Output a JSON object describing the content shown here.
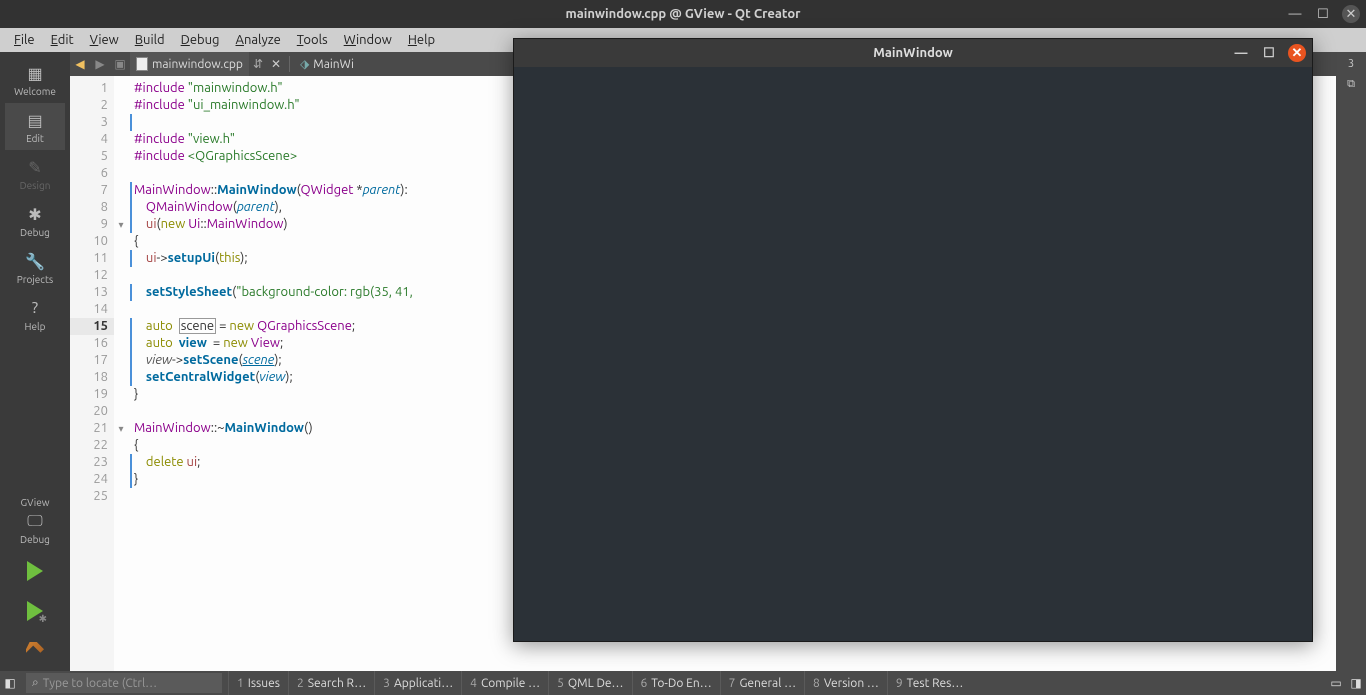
{
  "window": {
    "title": "mainwindow.cpp @ GView - Qt Creator"
  },
  "menu": [
    "File",
    "Edit",
    "View",
    "Build",
    "Debug",
    "Analyze",
    "Tools",
    "Window",
    "Help"
  ],
  "sidebar": {
    "items": [
      {
        "label": "Welcome",
        "icon": "grid"
      },
      {
        "label": "Edit",
        "icon": "doc",
        "active": true
      },
      {
        "label": "Design",
        "icon": "pencil",
        "disabled": true
      },
      {
        "label": "Debug",
        "icon": "bug"
      },
      {
        "label": "Projects",
        "icon": "wrench"
      },
      {
        "label": "Help",
        "icon": "help"
      }
    ],
    "project": "GView",
    "config": "Debug"
  },
  "tabs": {
    "current": "mainwindow.cpp",
    "secondary": "MainWi"
  },
  "code_lines": [
    [
      {
        "t": "pp",
        "s": "#include "
      },
      {
        "t": "str",
        "s": "\"mainwindow.h\""
      }
    ],
    [
      {
        "t": "pp",
        "s": "#include "
      },
      {
        "t": "str",
        "s": "\"ui_mainwindow.h\""
      }
    ],
    [],
    [
      {
        "t": "pp",
        "s": "#include "
      },
      {
        "t": "str",
        "s": "\"view.h\""
      }
    ],
    [
      {
        "t": "pp",
        "s": "#include "
      },
      {
        "t": "inc",
        "s": "<QGraphicsScene>"
      }
    ],
    [],
    [
      {
        "t": "cls",
        "s": "MainWindow"
      },
      {
        "t": "",
        "s": "::"
      },
      {
        "t": "fn",
        "s": "MainWindow"
      },
      {
        "t": "",
        "s": "("
      },
      {
        "t": "cls",
        "s": "QWidget"
      },
      {
        "t": "",
        "s": " *"
      },
      {
        "t": "ital",
        "s": "parent"
      },
      {
        "t": "",
        "s": "):"
      }
    ],
    [
      {
        "t": "",
        "s": "    "
      },
      {
        "t": "cls",
        "s": "QMainWindow"
      },
      {
        "t": "",
        "s": "("
      },
      {
        "t": "ital",
        "s": "parent"
      },
      {
        "t": "",
        "s": "),"
      }
    ],
    [
      {
        "t": "",
        "s": "    "
      },
      {
        "t": "member",
        "s": "ui"
      },
      {
        "t": "",
        "s": "("
      },
      {
        "t": "kw",
        "s": "new"
      },
      {
        "t": "",
        "s": " "
      },
      {
        "t": "cls",
        "s": "Ui"
      },
      {
        "t": "",
        "s": "::"
      },
      {
        "t": "cls",
        "s": "MainWindow"
      },
      {
        "t": "",
        "s": ")"
      }
    ],
    [
      {
        "t": "",
        "s": "{"
      }
    ],
    [
      {
        "t": "",
        "s": "    "
      },
      {
        "t": "member",
        "s": "ui"
      },
      {
        "t": "",
        "s": "->"
      },
      {
        "t": "fn",
        "s": "setupUi"
      },
      {
        "t": "",
        "s": "("
      },
      {
        "t": "kw",
        "s": "this"
      },
      {
        "t": "",
        "s": ");"
      }
    ],
    [],
    [
      {
        "t": "",
        "s": "    "
      },
      {
        "t": "fn",
        "s": "setStyleSheet"
      },
      {
        "t": "",
        "s": "("
      },
      {
        "t": "str",
        "s": "\"background-color: rgb(35, 41,"
      }
    ],
    [],
    [
      {
        "t": "",
        "s": "    "
      },
      {
        "t": "kw",
        "s": "auto"
      },
      {
        "t": "",
        "s": "  "
      },
      {
        "t": "boxed",
        "s": "scene"
      },
      {
        "t": "",
        "s": " = "
      },
      {
        "t": "kw",
        "s": "new"
      },
      {
        "t": "",
        "s": " "
      },
      {
        "t": "cls",
        "s": "QGraphicsScene"
      },
      {
        "t": "",
        "s": ";"
      }
    ],
    [
      {
        "t": "",
        "s": "    "
      },
      {
        "t": "kw",
        "s": "auto"
      },
      {
        "t": "",
        "s": "  "
      },
      {
        "t": "fn",
        "s": "view"
      },
      {
        "t": "",
        "s": "  = "
      },
      {
        "t": "kw",
        "s": "new"
      },
      {
        "t": "",
        "s": " "
      },
      {
        "t": "cls",
        "s": "View"
      },
      {
        "t": "",
        "s": ";"
      }
    ],
    [
      {
        "t": "",
        "s": "    "
      },
      {
        "t": "var",
        "s": "view"
      },
      {
        "t": "",
        "s": "->"
      },
      {
        "t": "fn",
        "s": "setScene"
      },
      {
        "t": "",
        "s": "("
      },
      {
        "t": "ital u",
        "s": "scene"
      },
      {
        "t": "",
        "s": ");"
      }
    ],
    [
      {
        "t": "",
        "s": "    "
      },
      {
        "t": "fn",
        "s": "setCentralWidget"
      },
      {
        "t": "",
        "s": "("
      },
      {
        "t": "ital",
        "s": "view"
      },
      {
        "t": "",
        "s": ");"
      }
    ],
    [
      {
        "t": "",
        "s": "}"
      }
    ],
    [],
    [
      {
        "t": "cls",
        "s": "MainWindow"
      },
      {
        "t": "",
        "s": "::~"
      },
      {
        "t": "fn",
        "s": "MainWindow"
      },
      {
        "t": "",
        "s": "()"
      }
    ],
    [
      {
        "t": "",
        "s": "{"
      }
    ],
    [
      {
        "t": "",
        "s": "    "
      },
      {
        "t": "kw",
        "s": "delete"
      },
      {
        "t": "",
        "s": " "
      },
      {
        "t": "member",
        "s": "ui"
      },
      {
        "t": "",
        "s": ";"
      }
    ],
    [
      {
        "t": "",
        "s": "}"
      }
    ],
    []
  ],
  "current_line": 15,
  "fold_lines": [
    9,
    21
  ],
  "statusbar": {
    "locator_placeholder": "Type to locate (Ctrl…",
    "panes": [
      {
        "n": "1",
        "label": "Issues"
      },
      {
        "n": "2",
        "label": "Search R…"
      },
      {
        "n": "3",
        "label": "Applicati…"
      },
      {
        "n": "4",
        "label": "Compile …"
      },
      {
        "n": "5",
        "label": "QML De…"
      },
      {
        "n": "6",
        "label": "To-Do En…"
      },
      {
        "n": "7",
        "label": "General …"
      },
      {
        "n": "8",
        "label": "Version …"
      },
      {
        "n": "9",
        "label": "Test Res…"
      }
    ]
  },
  "childwin": {
    "title": "MainWindow"
  },
  "rightbar_label": "3"
}
